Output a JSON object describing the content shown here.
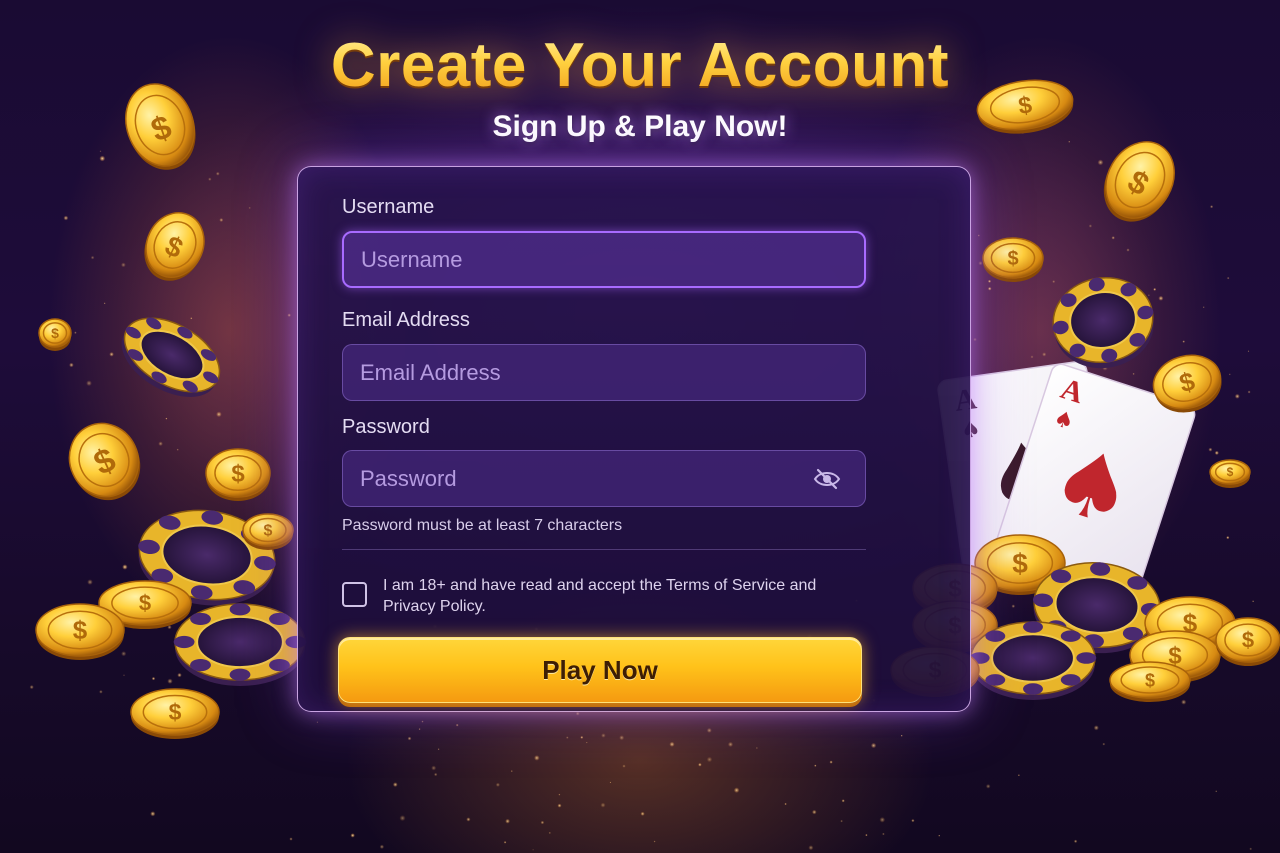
{
  "header": {
    "title": "Create Your Account",
    "subtitle": "Sign Up & Play Now!"
  },
  "form": {
    "username": {
      "label": "Username",
      "placeholder": "Username",
      "value": ""
    },
    "email": {
      "label": "Email Address",
      "placeholder": "Email Address",
      "value": ""
    },
    "password": {
      "label": "Password",
      "placeholder": "Password",
      "value": "",
      "toggle_icon": "eye-slash-icon",
      "hint": "Password must be at least 7 characters"
    },
    "terms": {
      "checked": false,
      "text": "I am 18+ and have read and accept the Terms of Service and Privacy Policy."
    },
    "submit_label": "Play Now"
  },
  "decorations": {
    "coin_symbol": "$",
    "card_rank": "A",
    "card_suit": "♠",
    "icons": [
      "gold-coin-icon",
      "poker-chip-icon",
      "playing-card-icon"
    ]
  },
  "colors": {
    "title_gold": "#ffd140",
    "accent_purple": "#a86bff",
    "button_yellow": "#ffc21a",
    "background": "#1e0c3a",
    "card_suit_red": "#c0262d"
  }
}
